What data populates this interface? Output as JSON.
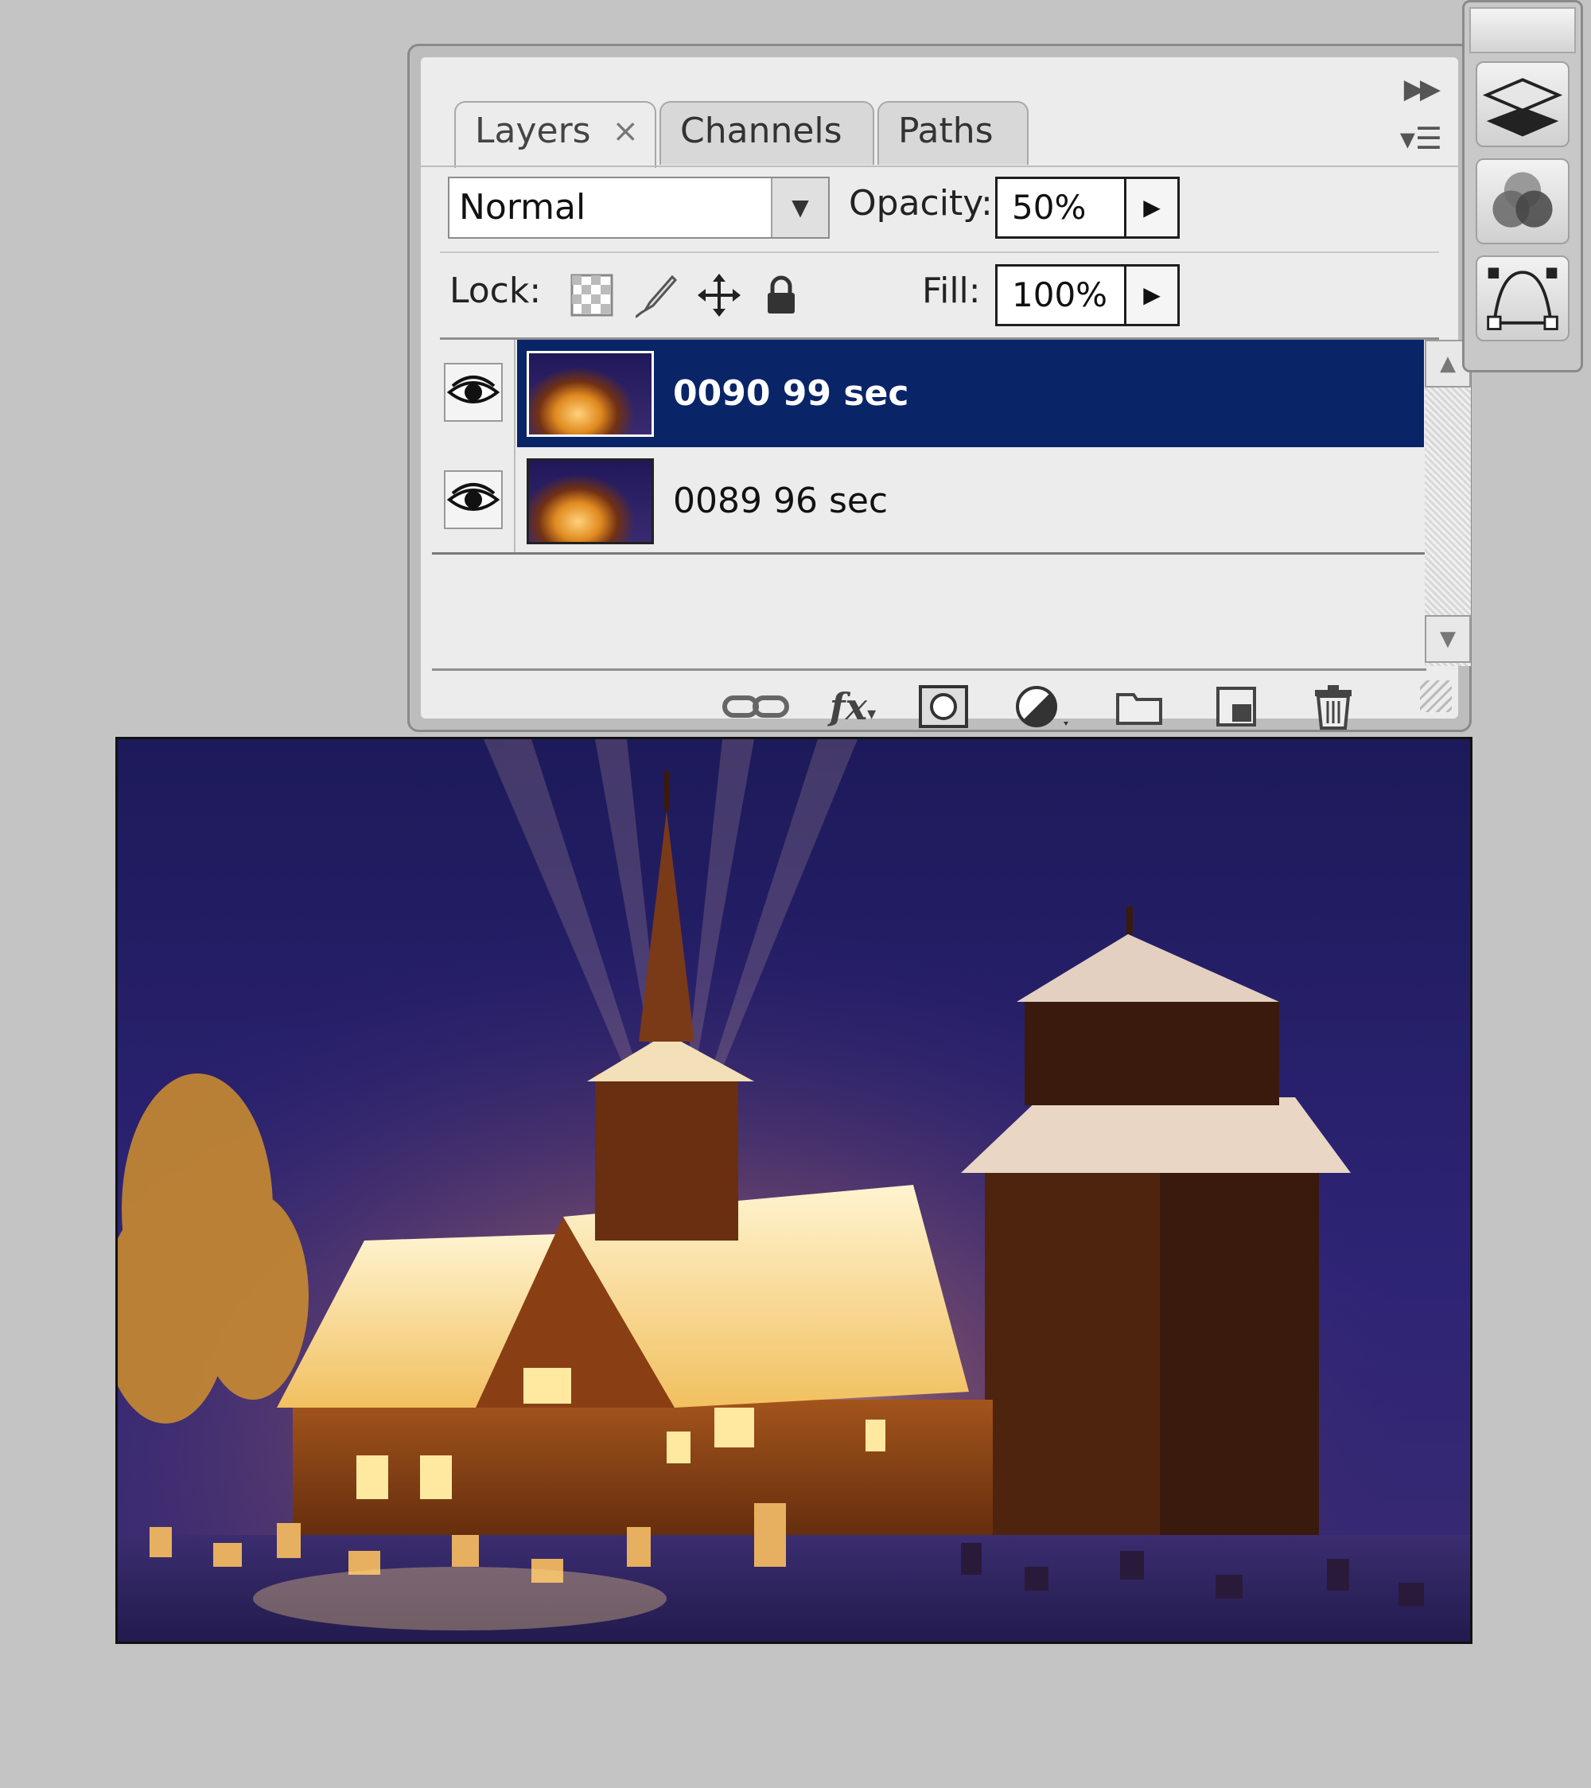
{
  "layers_panel": {
    "tabs": [
      {
        "label": "Layers",
        "close": "×",
        "active": true
      },
      {
        "label": "Channels",
        "active": false
      },
      {
        "label": "Paths",
        "active": false
      }
    ],
    "collapse_icon": "double-arrow-right-icon",
    "menu_icon": "panel-menu-icon",
    "blend_mode": "Normal",
    "opacity_label": "Opacity:",
    "opacity_value": "50%",
    "lock_label": "Lock:",
    "lock_icons": [
      "lock-transparent-pixels-icon",
      "lock-image-pixels-icon",
      "lock-position-icon",
      "lock-all-icon"
    ],
    "fill_label": "Fill:",
    "fill_value": "100%",
    "layers": [
      {
        "name": "0090 99 sec",
        "visible": true,
        "selected": true
      },
      {
        "name": "0089 96 sec",
        "visible": true,
        "selected": false
      }
    ],
    "footer_icons": [
      "link-layers-icon",
      "fx-icon",
      "layer-mask-icon",
      "adjustment-layer-icon",
      "new-group-icon",
      "new-layer-icon",
      "trash-icon"
    ],
    "fx_label": "fx"
  },
  "dock": {
    "icons": [
      "layers-panel-icon",
      "channels-panel-icon",
      "paths-panel-icon"
    ]
  },
  "canvas": {
    "description_icon": "church-night-photo"
  },
  "colors": {
    "selected_row": "#0a2468",
    "background": "#c4c4c4"
  }
}
